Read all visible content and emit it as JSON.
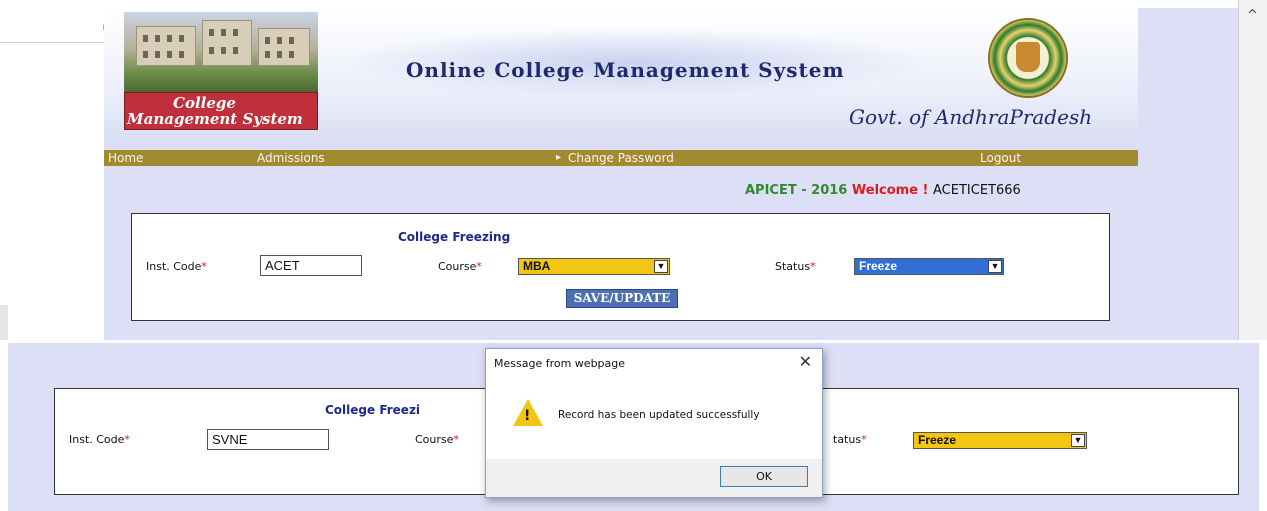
{
  "top_page": {
    "logo_caption_line1": "College",
    "logo_caption_line2": "Management System",
    "site_title": "Online College Management System",
    "govt_text": "Govt. of AndhraPradesh",
    "stray_text": "g",
    "scroll_glyph": "^",
    "nav": {
      "home": "Home",
      "admissions": "Admissions",
      "change_password_arrow": "▸",
      "change_password": "Change Password",
      "logout": "Logout"
    },
    "welcome": {
      "exam": "APICET - 2016",
      "welcome_word": "Welcome !",
      "user": "ACETICET666"
    },
    "form": {
      "title": "College Freezing",
      "inst_code_label": "Inst. Code",
      "inst_code_value": "ACET",
      "course_label": "Course",
      "course_value": "MBA",
      "course_bg": "#f3c614",
      "status_label": "Status",
      "status_value": "Freeze",
      "status_bg": "#2f6fd6",
      "required_mark": "*",
      "save_button": "SAVE/UPDATE"
    }
  },
  "bottom_page": {
    "form": {
      "title": "College Freezi",
      "inst_code_label": "Inst. Code",
      "inst_code_value": "SVNE",
      "course_label": "Course",
      "status_label": "tatus",
      "status_value": "Freeze",
      "status_bg": "#f3c614",
      "required_mark": "*"
    }
  },
  "dialog": {
    "title": "Message from webpage",
    "close_glyph": "✕",
    "warning_glyph": "!",
    "message": "Record has been updated  successfully",
    "ok_button": "OK"
  },
  "colors": {
    "nav_bg": "#a48a2f",
    "page_bg": "#dcdff5",
    "title_blue": "#1c2a8c",
    "required_red": "#e01b1b"
  }
}
